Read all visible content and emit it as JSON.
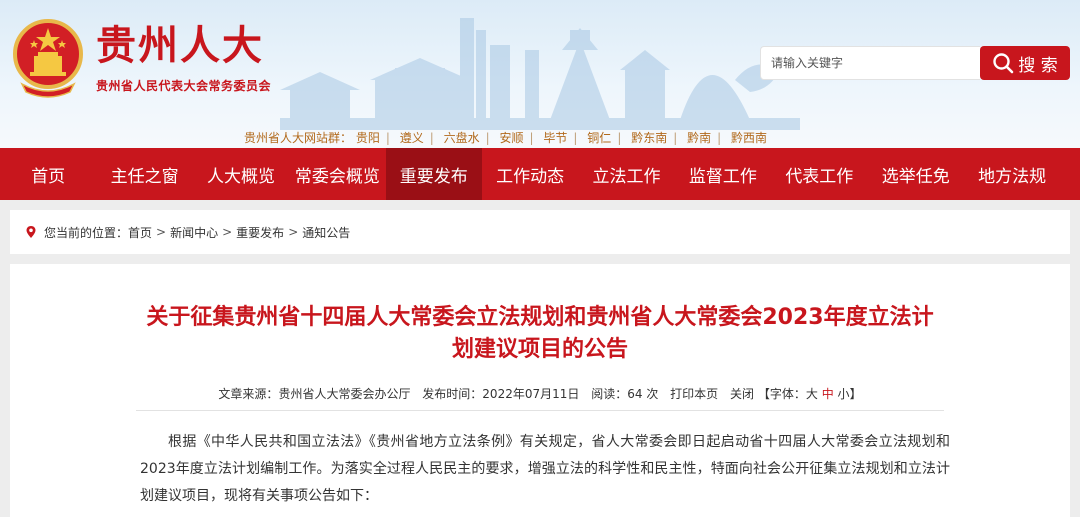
{
  "header": {
    "site_title": "贵州人大",
    "site_subtitle": "贵州省人民代表大会常务委员会",
    "search": {
      "placeholder": "请输入关键字",
      "button_label": "搜 索"
    },
    "station_label": "贵州省人大网站群：",
    "stations": [
      "贵阳",
      "遵义",
      "六盘水",
      "安顺",
      "毕节",
      "铜仁",
      "黔东南",
      "黔南",
      "黔西南"
    ]
  },
  "nav": {
    "items": [
      "首页",
      "主任之窗",
      "人大概览",
      "常委会概览",
      "重要发布",
      "工作动态",
      "立法工作",
      "监督工作",
      "代表工作",
      "选举任免",
      "地方法规"
    ],
    "active": "重要发布"
  },
  "breadcrumb": {
    "prefix": "您当前的位置：",
    "items": [
      "首页",
      "新闻中心",
      "重要发布",
      "通知公告"
    ],
    "separator": ">"
  },
  "article": {
    "title": "关于征集贵州省十四届人大常委会立法规划和贵州省人大常委会2023年度立法计划建议项目的公告",
    "meta": {
      "source_label": "文章来源：",
      "source": "贵州省人大常委会办公厅",
      "date_label": "发布时间：",
      "date": "2022年07月11日",
      "views_label": "阅读：",
      "views": "64 次",
      "print": "打印本页",
      "close": "关闭",
      "font_open": "【字体：",
      "font_large": "大",
      "font_medium": "中",
      "font_small": "小",
      "font_close": "】"
    },
    "paragraph": "根据《中华人民共和国立法法》《贵州省地方立法条例》有关规定，省人大常委会即日起启动省十四届人大常委会立法规划和2023年度立法计划编制工作。为落实全过程人民民主的要求，增强立法的科学性和民主性，特面向社会公开征集立法规划和立法计划建议项目，现将有关事项公告如下："
  },
  "colors": {
    "brand_red": "#c8161d",
    "nav_active": "#9a0f15",
    "station_text": "#b26a1d"
  }
}
